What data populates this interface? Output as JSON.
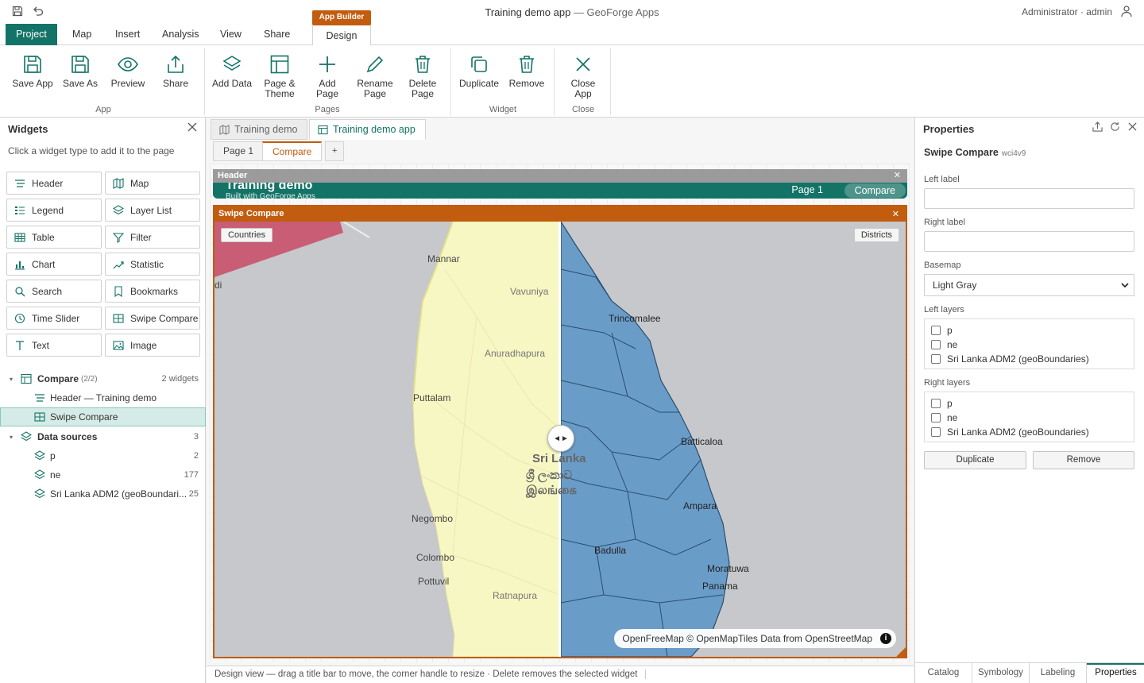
{
  "titlebar": {
    "app_title": "Training demo app",
    "app_subtitle": "— GeoForge Apps",
    "user": "Administrator · admin",
    "context_badge": "App Builder"
  },
  "ribbon_tabs": [
    "Project",
    "Map",
    "Insert",
    "Analysis",
    "View",
    "Share",
    "Design"
  ],
  "ribbon": {
    "app": {
      "label": "App",
      "buttons": [
        "Save App",
        "Save As",
        "Preview",
        "Share"
      ]
    },
    "pages": {
      "label": "Pages",
      "buttons": [
        [
          "Add Data",
          ""
        ],
        [
          "Page &",
          "Theme"
        ],
        [
          "Add",
          "Page"
        ],
        [
          "Rename",
          "Page"
        ],
        [
          "Delete",
          "Page"
        ]
      ]
    },
    "widget": {
      "label": "Widget",
      "buttons": [
        "Duplicate",
        "Remove"
      ]
    },
    "close": {
      "label": "Close",
      "buttons": [
        [
          "Close",
          "App"
        ]
      ]
    }
  },
  "widgets_panel": {
    "title": "Widgets",
    "hint": "Click a widget type to add it to the page",
    "types": [
      "Header",
      "Map",
      "Legend",
      "Layer List",
      "Table",
      "Filter",
      "Chart",
      "Statistic",
      "Search",
      "Bookmarks",
      "Time Slider",
      "Swipe Compare",
      "Text",
      "Image"
    ],
    "tree": {
      "page": {
        "label": "Compare",
        "meta": "(2/2)",
        "count": "2 widgets"
      },
      "page_items": [
        "Header — Training demo",
        "Swipe Compare"
      ],
      "sources": {
        "label": "Data sources",
        "count": "3"
      },
      "source_items": [
        {
          "label": "p",
          "count": "2"
        },
        {
          "label": "ne",
          "count": "177"
        },
        {
          "label": "Sri Lanka ADM2 (geoBoundari...",
          "count": "25"
        }
      ]
    }
  },
  "doc_tabs": [
    "Training demo",
    "Training demo app"
  ],
  "page_tabs": [
    "Page 1",
    "Compare",
    "+"
  ],
  "header_widget": {
    "bar": "Header",
    "title": "Training demo",
    "subtitle": "Built with GeoForge Apps",
    "nav": [
      "Page 1",
      "Compare"
    ]
  },
  "swipe_widget": {
    "bar": "Swipe Compare",
    "left_chip": "Countries",
    "right_chip": "Districts",
    "handle": "◄►",
    "places": [
      "Mannar",
      "Vavuniya",
      "Trincomalee",
      "Anuradhapura",
      "Puttalam",
      "Batticaloa",
      "Sri Lanka",
      "ශ්‍රී ලංකාව",
      "இலங்கை",
      "Negombo",
      "Ampara",
      "Badulla",
      "Colombo",
      "Moratuwa",
      "Pottuvil",
      "Panama",
      "Ratnapura",
      "di"
    ],
    "attribution": {
      "a": "OpenFreeMap",
      "b": "© OpenMapTiles",
      "c": "Data from",
      "d": "OpenStreetMap",
      "info": "i"
    }
  },
  "status": "Design view — drag a title bar to move, the corner handle to resize · Delete removes the selected widget",
  "properties": {
    "title": "Properties",
    "widget_name": "Swipe Compare",
    "widget_id": "wci4v9",
    "left_label": "Left label",
    "right_label": "Right label",
    "left_value": "",
    "right_value": "",
    "basemap_label": "Basemap",
    "basemap_value": "Light Gray",
    "left_layers_label": "Left layers",
    "right_layers_label": "Right layers",
    "layers": [
      "p",
      "ne",
      "Sri Lanka ADM2 (geoBoundaries)"
    ],
    "duplicate": "Duplicate",
    "remove": "Remove",
    "bottom_tabs": [
      "Catalog",
      "Symbology",
      "Labeling",
      "Properties"
    ]
  },
  "colors": {
    "accent": "#137367",
    "builder": "#c25c0e",
    "left_fill": "#f7f7c4",
    "right_fill": "#6a9cc8",
    "country_fill": "#c9516b"
  }
}
